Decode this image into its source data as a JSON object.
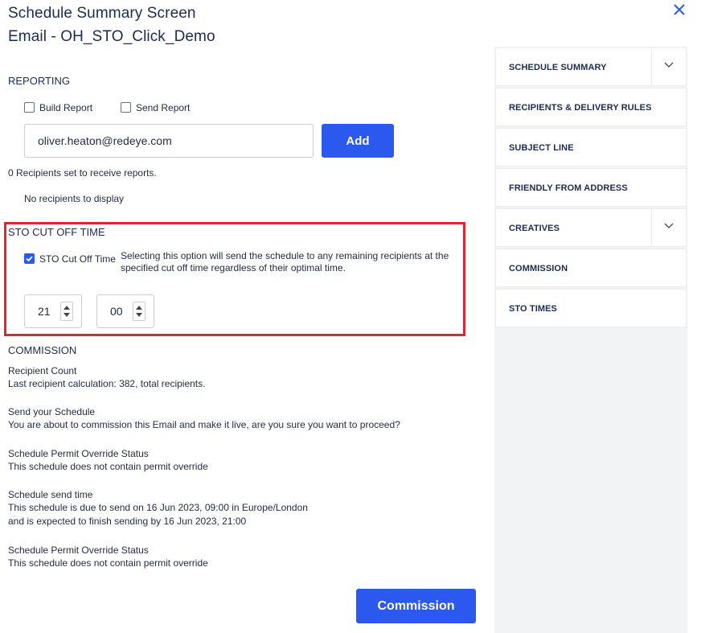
{
  "header": {
    "title_line1": "Schedule Summary Screen",
    "title_line2": "Email - OH_STO_Click_Demo",
    "close_icon": "close-icon"
  },
  "reporting": {
    "heading": "REPORTING",
    "build_report_label": "Build Report",
    "send_report_label": "Send Report",
    "build_report_checked": false,
    "send_report_checked": false,
    "email_value": "oliver.heaton@redeye.com",
    "add_label": "Add",
    "recipients_count_text": "0 Recipients set to receive reports.",
    "no_recipients_text": "No recipients to display"
  },
  "sto": {
    "heading": "STO CUT OFF TIME",
    "checkbox_label": "STO Cut Off Time",
    "checked": true,
    "description_line1": "Selecting this option will send the schedule to any remaining recipients at the",
    "description_line2": "specified cut off time regardless of their optimal time.",
    "hour": "21",
    "minute": "00"
  },
  "commission": {
    "heading": "COMMISSION",
    "blocks": [
      {
        "label": "Recipient Count",
        "lines": [
          "Last recipient calculation: 382, total recipients."
        ]
      },
      {
        "label": "Send your Schedule",
        "lines": [
          "You are about to commission this Email and make it live, are you sure you want to proceed?"
        ]
      },
      {
        "label": "Schedule Permit Override Status",
        "lines": [
          "This schedule does not contain permit override"
        ]
      },
      {
        "label": "Schedule send time",
        "lines": [
          "This schedule is due to send on 16 Jun 2023, 09:00 in Europe/London",
          "and is expected to finish sending by 16 Jun 2023, 21:00"
        ]
      },
      {
        "label": "Schedule Permit Override Status",
        "lines": [
          "This schedule does not contain permit override"
        ]
      }
    ],
    "button_label": "Commission"
  },
  "sidebar": {
    "items": [
      {
        "label": "SCHEDULE SUMMARY",
        "has_chevron": true
      },
      {
        "label": "RECIPIENTS & DELIVERY RULES",
        "has_chevron": false
      },
      {
        "label": "SUBJECT LINE",
        "has_chevron": false
      },
      {
        "label": "FRIENDLY FROM ADDRESS",
        "has_chevron": false
      },
      {
        "label": "CREATIVES",
        "has_chevron": true
      },
      {
        "label": "COMMISSION",
        "has_chevron": false
      },
      {
        "label": "STO TIMES",
        "has_chevron": false
      }
    ]
  },
  "colors": {
    "accent": "#2b59f0",
    "highlight_border": "#e3262e",
    "sidebar_bg": "#f2f3f5"
  }
}
